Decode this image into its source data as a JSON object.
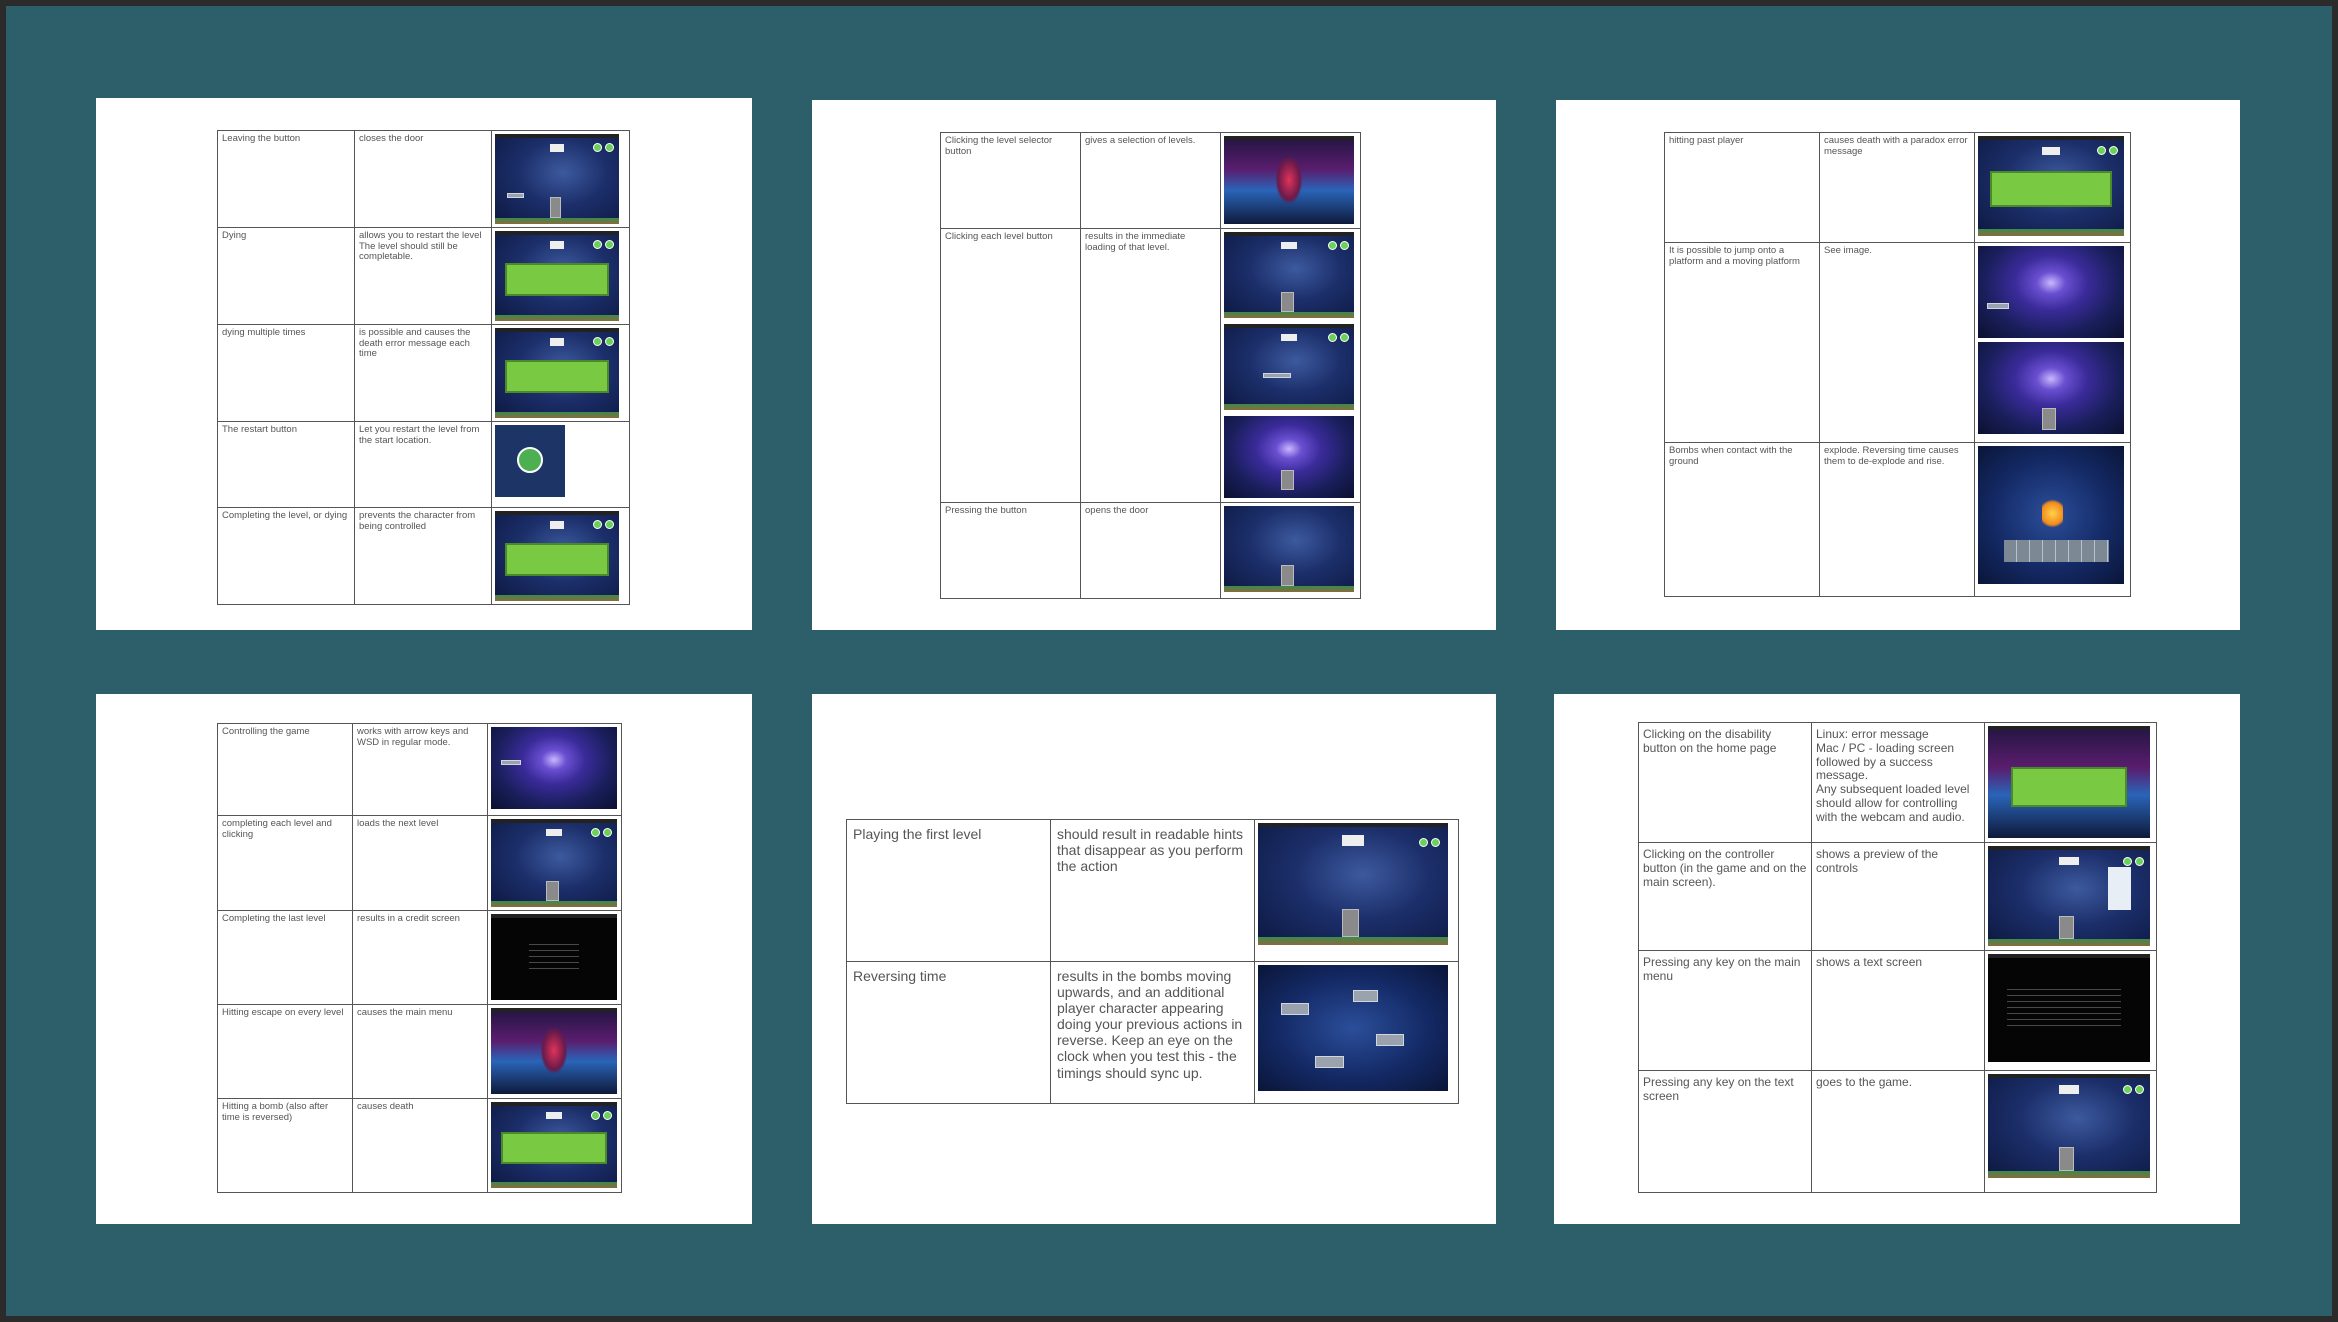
{
  "pages": [
    {
      "rows": [
        {
          "action": "Leaving the button",
          "result": "closes the door",
          "image": "game-level-door-closed"
        },
        {
          "action": "Dying",
          "result": "allows you to restart the level\nThe level should still be completable.",
          "image": "game-over-screen"
        },
        {
          "action": "dying multiple times",
          "result": "is possible and causes the death error message each time",
          "image": "game-over-screen"
        },
        {
          "action": "The restart button",
          "result": "Let you restart the level from the start location.",
          "image": "restart-icon"
        },
        {
          "action": "Completing the level, or dying",
          "result": "prevents the character from being controlled",
          "image": "paradox-screen"
        }
      ]
    },
    {
      "rows": [
        {
          "action": "Clicking the level selector button",
          "result": "gives a selection of levels.",
          "image": "level-selector-screen"
        },
        {
          "action": "Clicking each level button",
          "result": "results in the immediate loading of that level.",
          "image": "level-screens"
        },
        {
          "action": "Pressing the button",
          "result": "opens the door",
          "image": "game-level-door-open"
        }
      ]
    },
    {
      "rows": [
        {
          "action": "hitting past player",
          "result": "causes death with a paradox error message",
          "image": "paradox-screen"
        },
        {
          "action": "It is possible to jump onto a platform and a moving platform",
          "result": "See image.",
          "image": "platform-screens"
        },
        {
          "action": "Bombs when contact with the ground",
          "result": "explode. Reversing time causes them to de-explode and rise.",
          "image": "bomb-explosion"
        }
      ]
    },
    {
      "rows": [
        {
          "action": "Controlling the game",
          "result": " works with arrow keys and WSD in regular mode.",
          "image": "space-level"
        },
        {
          "action": "completing each level and clicking",
          "result": "loads the next level",
          "image": "game-level"
        },
        {
          "action": "Completing the last level",
          "result": "results in a credit screen",
          "image": "credits-screen"
        },
        {
          "action": "Hitting escape on every level",
          "result": "causes the main menu",
          "image": "main-menu"
        },
        {
          "action": "Hitting a bomb (also after time is reversed)",
          "result": "causes death",
          "image": "game-over-screen"
        }
      ]
    },
    {
      "rows": [
        {
          "action": "Playing the first level",
          "result": "should result in readable hints that disappear as you perform the action",
          "image": "game-level"
        },
        {
          "action": "Reversing time",
          "result": "results in the bombs moving upwards, and an additional player character appearing doing your previous actions in reverse. Keep an eye on the clock when you test this - the timings should sync up.",
          "image": "reverse-time-level"
        }
      ]
    },
    {
      "rows": [
        {
          "action": "Clicking on the disability button on the home page",
          "result": "Linux: error message\nMac / PC - loading screen followed by a success message.\nAny subsequent loaded level should allow for controlling with the webcam and audio.",
          "image": "disability-mode-loading"
        },
        {
          "action": "Clicking on the controller button (in the game and on the main screen).",
          "result": "shows a preview of the controls",
          "image": "controller-preview"
        },
        {
          "action": "Pressing any key on the main menu",
          "result": "shows a text screen",
          "image": "text-screen"
        },
        {
          "action": "Pressing any key on the text screen",
          "result": "goes to the game.",
          "image": "game-level"
        }
      ]
    }
  ]
}
